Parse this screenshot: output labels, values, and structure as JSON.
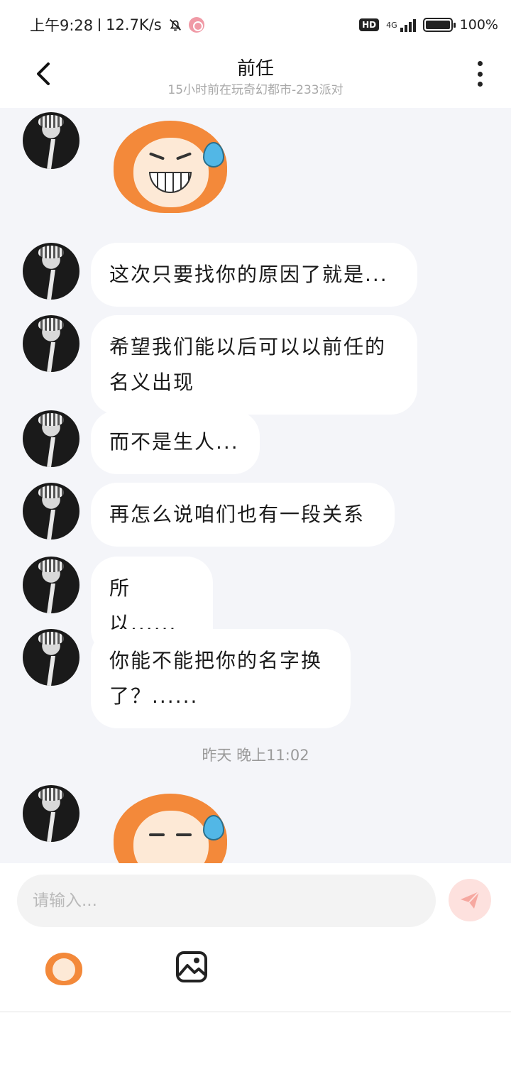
{
  "status_bar": {
    "time": "上午9:28",
    "speed": "12.7K/s",
    "network_badge": "HD",
    "network_type": "4G",
    "battery": "100%",
    "battery_level": 1.0
  },
  "header": {
    "title": "前任",
    "subtitle": "15小时前在玩奇幻都市-233派对"
  },
  "messages": [
    {
      "type": "sticker",
      "sticker": "orange-hair-grimace-sweat"
    },
    {
      "type": "text",
      "text": "这次只要找你的原因了就是..."
    },
    {
      "type": "text",
      "text": "希望我们能以后可以以前任的名义出现"
    },
    {
      "type": "text",
      "text": "而不是生人..."
    },
    {
      "type": "text",
      "text": "再怎么说咱们也有一段关系"
    },
    {
      "type": "text",
      "text": "所以......"
    },
    {
      "type": "text",
      "text": "你能不能把你的名字换了？......"
    },
    {
      "type": "timestamp",
      "text": "昨天 晚上11:02"
    },
    {
      "type": "sticker",
      "sticker": "orange-hair-side-eye-sweat"
    }
  ],
  "input": {
    "placeholder": "请输入..."
  },
  "colors": {
    "chat_background": "#f4f5f9",
    "bubble": "#ffffff",
    "send_button": "#fde1de",
    "send_icon": "#f6a8a0",
    "sticker_hair": "#f3893a",
    "sweat_drop": "#52b7e6"
  },
  "icons": [
    "back-arrow-icon",
    "more-vertical-icon",
    "send-icon",
    "emoji-sticker-icon",
    "image-icon",
    "bell-muted-icon"
  ]
}
